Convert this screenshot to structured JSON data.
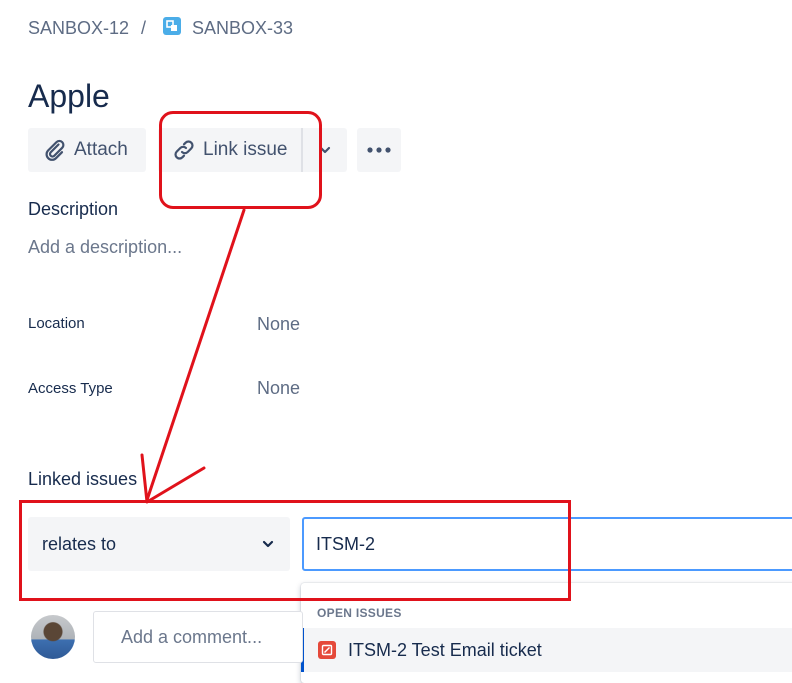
{
  "breadcrumb": {
    "parent": "SANBOX-12",
    "separator": "/",
    "current": "SANBOX-33"
  },
  "issue": {
    "title": "Apple"
  },
  "toolbar": {
    "attach_label": "Attach",
    "link_issue_label": "Link issue"
  },
  "description": {
    "label": "Description",
    "placeholder": "Add a description..."
  },
  "fields": [
    {
      "label": "Location",
      "value": "None"
    },
    {
      "label": "Access Type",
      "value": "None"
    }
  ],
  "linked_issues": {
    "title": "Linked issues",
    "relation": "relates to",
    "search_value": "ITSM-2",
    "dropdown": {
      "section_header": "OPEN ISSUES",
      "items": [
        {
          "text": "ITSM-2 Test Email ticket",
          "icon": "incident-icon"
        }
      ]
    }
  },
  "comment": {
    "placeholder": "Add a comment..."
  },
  "colors": {
    "annotation": "#e0121b",
    "focus_border": "#4c9aff",
    "link_accent": "#0052cc"
  }
}
